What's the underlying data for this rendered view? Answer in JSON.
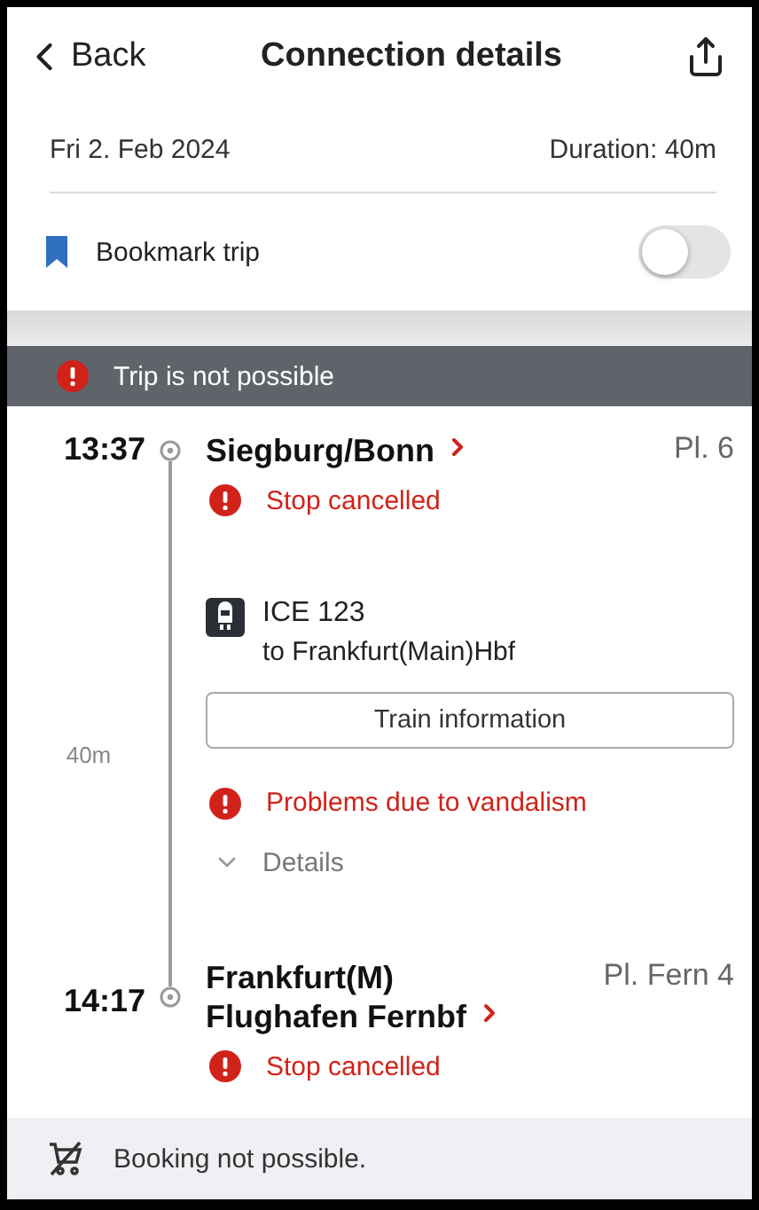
{
  "header": {
    "back_label": "Back",
    "title": "Connection details"
  },
  "trip": {
    "date": "Fri 2. Feb 2024",
    "duration": "Duration: 40m"
  },
  "bookmark": {
    "label": "Bookmark trip",
    "on": false
  },
  "banner": {
    "text": "Trip is not possible"
  },
  "departure": {
    "time": "13:37",
    "station": "Siegburg/Bonn",
    "platform": "Pl. 6",
    "notice": "Stop cancelled"
  },
  "segment": {
    "duration": "40m",
    "train": "ICE 123",
    "destination": "to Frankfurt(Main)Hbf",
    "button": "Train information",
    "notice": "Problems due to vandalism",
    "details": {
      "label": "Details",
      "expanded": false
    }
  },
  "arrival": {
    "time": "14:17",
    "station_lines": [
      "Frankfurt(M)",
      "Flughafen Fernbf"
    ],
    "platform": "Pl. Fern 4",
    "notice": "Stop cancelled"
  },
  "footer": {
    "text": "Booking not possible."
  }
}
